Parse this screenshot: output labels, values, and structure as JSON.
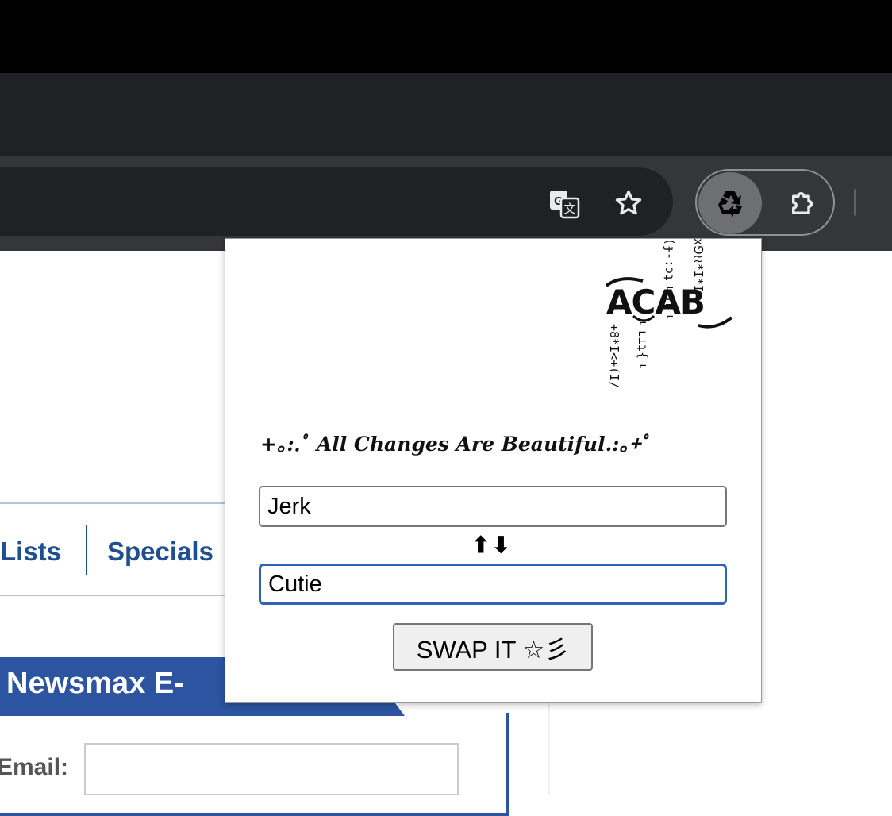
{
  "browser": {
    "toolbar_icons": [
      "translate-icon",
      "star-icon",
      "recycle-icon",
      "puzzle-icon"
    ]
  },
  "page": {
    "nav": [
      "Lists",
      "Specials"
    ],
    "newsletter_title": "Newsmax E-",
    "email_label": "Email:",
    "accent_color": "#2c54a0"
  },
  "popup": {
    "logo_text": "ACAB",
    "logo_glyph_columns": [
      "+8*I<+(I/",
      "⌐ʟ⊥ʇ{⌐",
      "(ɟ-:ɔʇ⌐)ʟ⌐",
      "x⅁≀≀*I*I"
    ],
    "tagline": "+｡:.ﾟ All Changes Are Beautiful.:｡+ﾟ",
    "from_value": "Jerk",
    "to_value": "Cutie",
    "arrows": "⬆⬇",
    "swap_label": "SWAP IT ☆彡"
  }
}
